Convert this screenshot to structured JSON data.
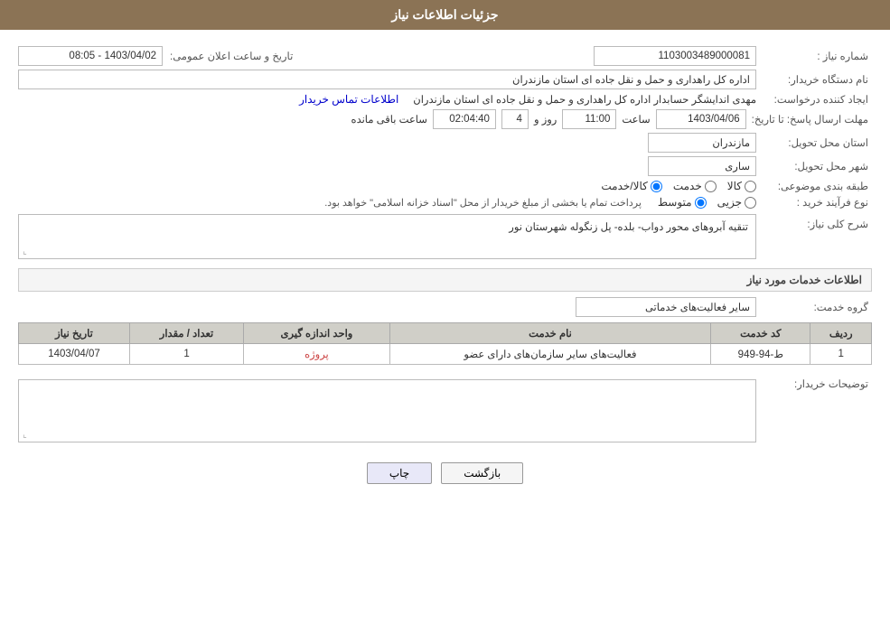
{
  "header": {
    "title": "جزئیات اطلاعات نیاز"
  },
  "fields": {
    "need_number_label": "شماره نیاز :",
    "need_number_value": "1103003489000081",
    "announcement_label": "تاریخ و ساعت اعلان عمومی:",
    "announcement_value": "1403/04/02 - 08:05",
    "buyer_org_label": "نام دستگاه خریدار:",
    "buyer_org_value": "اداره کل راهداری و حمل و نقل جاده ای استان مازندران",
    "creator_label": "ایجاد کننده درخواست:",
    "creator_value": "مهدی اندایشگر حسابدار اداره کل راهداری و حمل و نقل جاده ای استان مازندران",
    "contact_link": "اطلاعات تماس خریدار",
    "deadline_label": "مهلت ارسال پاسخ: تا تاریخ:",
    "deadline_date": "1403/04/06",
    "deadline_time_label": "ساعت",
    "deadline_time": "11:00",
    "deadline_days_label": "روز و",
    "deadline_days": "4",
    "deadline_remaining_label": "ساعت باقی مانده",
    "deadline_remaining": "02:04:40",
    "province_label": "استان محل تحویل:",
    "province_value": "مازندران",
    "city_label": "شهر محل تحویل:",
    "city_value": "ساری",
    "category_label": "طبقه بندی موضوعی:",
    "category_kala": "کالا",
    "category_khedmat": "خدمت",
    "category_kala_khedmat": "کالا/خدمت",
    "purchase_type_label": "نوع فرآیند خرید :",
    "purchase_type_jozi": "جزیی",
    "purchase_type_motavasset": "متوسط",
    "purchase_type_note": "پرداخت تمام یا بخشی از مبلغ خریدار از محل \"اسناد خزانه اسلامی\" خواهد بود.",
    "need_desc_label": "شرح کلی نیاز:",
    "need_desc_value": "تنقیه آبروهای محور دواب- بلده- پل زنگوله شهرستان نور",
    "services_section_label": "اطلاعات خدمات مورد نیاز",
    "service_group_label": "گروه خدمت:",
    "service_group_value": "سایر فعالیت‌های خدماتی",
    "table": {
      "headers": [
        "ردیف",
        "کد خدمت",
        "نام خدمت",
        "واحد اندازه گیری",
        "تعداد / مقدار",
        "تاریخ نیاز"
      ],
      "rows": [
        {
          "row": "1",
          "code": "ط-94-949",
          "name": "فعالیت‌های سایر سازمان‌های دارای عضو",
          "unit": "پروژه",
          "quantity": "1",
          "date": "1403/04/07"
        }
      ]
    },
    "buyer_desc_label": "توضیحات خریدار:",
    "btn_print": "چاپ",
    "btn_back": "بازگشت"
  }
}
